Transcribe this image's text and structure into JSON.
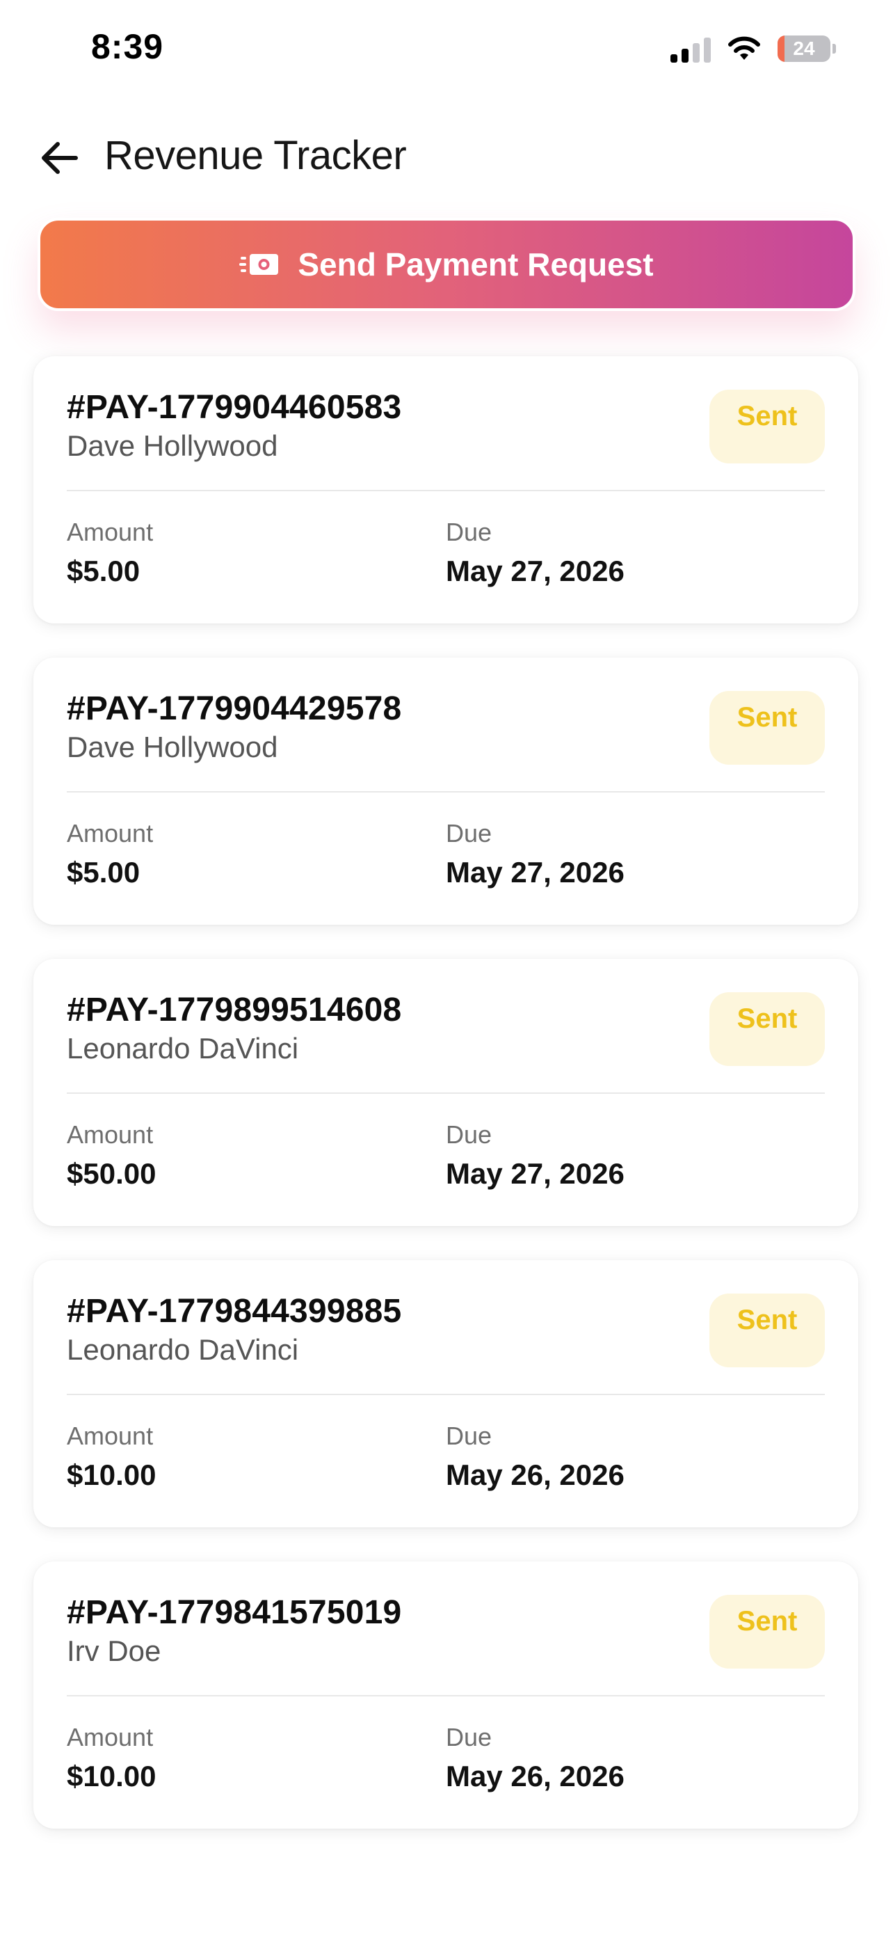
{
  "status_bar": {
    "time": "8:39",
    "battery_level": "24"
  },
  "header": {
    "title": "Revenue Tracker",
    "back_icon": "arrow-left-icon"
  },
  "cta": {
    "label": "Send Payment Request",
    "icon": "money-send-icon",
    "gradient": [
      "#f27a4a",
      "#c5469c"
    ]
  },
  "labels": {
    "amount": "Amount",
    "due": "Due"
  },
  "colors": {
    "badge_sent_bg": "#fdf6dc",
    "badge_sent_text": "#eec11c"
  },
  "payments": [
    {
      "id": "#PAY-1779904460583",
      "payer": "Dave Hollywood",
      "status": "Sent",
      "amount": "$5.00",
      "due": "May 27, 2026"
    },
    {
      "id": "#PAY-1779904429578",
      "payer": "Dave Hollywood",
      "status": "Sent",
      "amount": "$5.00",
      "due": "May 27, 2026"
    },
    {
      "id": "#PAY-1779899514608",
      "payer": "Leonardo DaVinci",
      "status": "Sent",
      "amount": "$50.00",
      "due": "May 27, 2026"
    },
    {
      "id": "#PAY-1779844399885",
      "payer": "Leonardo DaVinci",
      "status": "Sent",
      "amount": "$10.00",
      "due": "May 26, 2026"
    },
    {
      "id": "#PAY-1779841575019",
      "payer": "Irv Doe",
      "status": "Sent",
      "amount": "$10.00",
      "due": "May 26, 2026"
    }
  ]
}
